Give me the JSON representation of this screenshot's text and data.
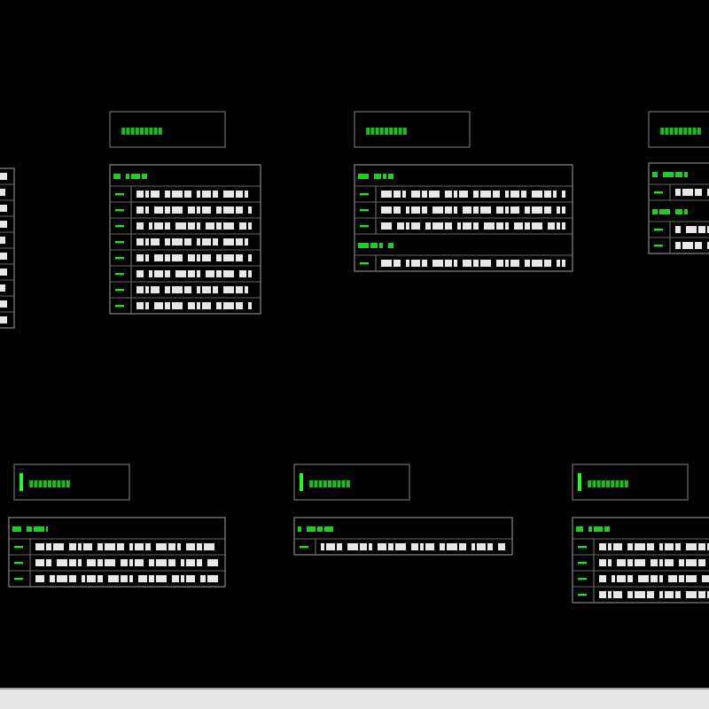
{
  "panels": [
    {
      "rows": [
        {
          "kind": "symbols"
        },
        {
          "kind": "symbols"
        },
        {
          "kind": "symbols"
        },
        {
          "kind": "symbols"
        },
        {
          "kind": "symbols"
        },
        {
          "kind": "symbols"
        },
        {
          "kind": "symbols"
        },
        {
          "kind": "symbols"
        },
        {
          "kind": "symbols"
        },
        {
          "kind": "symbols"
        }
      ]
    },
    {
      "title": {
        "bar": false
      },
      "rows": [
        {
          "kind": "header"
        },
        {
          "kind": "symbols"
        },
        {
          "kind": "symbols"
        },
        {
          "kind": "symbols"
        },
        {
          "kind": "symbols"
        },
        {
          "kind": "symbols"
        },
        {
          "kind": "symbols"
        },
        {
          "kind": "symbols"
        },
        {
          "kind": "symbols"
        }
      ]
    },
    {
      "title": {
        "bar": false
      },
      "rows": [
        {
          "kind": "header"
        },
        {
          "kind": "symbols"
        },
        {
          "kind": "symbols"
        },
        {
          "kind": "symbols"
        },
        {
          "kind": "header"
        },
        {
          "kind": "symbols"
        }
      ]
    },
    {
      "title": {
        "bar": false
      },
      "rows": [
        {
          "kind": "header"
        },
        {
          "kind": "symbols"
        },
        {
          "kind": "header"
        },
        {
          "kind": "symbols"
        },
        {
          "kind": "symbols"
        }
      ]
    },
    {
      "title": {
        "bar": true
      },
      "rows": [
        {
          "kind": "header"
        },
        {
          "kind": "symbols"
        },
        {
          "kind": "symbols"
        },
        {
          "kind": "symbols"
        }
      ]
    },
    {
      "title": {
        "bar": true
      },
      "rows": [
        {
          "kind": "header"
        },
        {
          "kind": "symbols"
        }
      ]
    },
    {
      "title": {
        "bar": true
      },
      "rows": [
        {
          "kind": "header"
        },
        {
          "kind": "symbols"
        },
        {
          "kind": "symbols"
        },
        {
          "kind": "symbols"
        },
        {
          "kind": "symbols"
        }
      ]
    }
  ]
}
